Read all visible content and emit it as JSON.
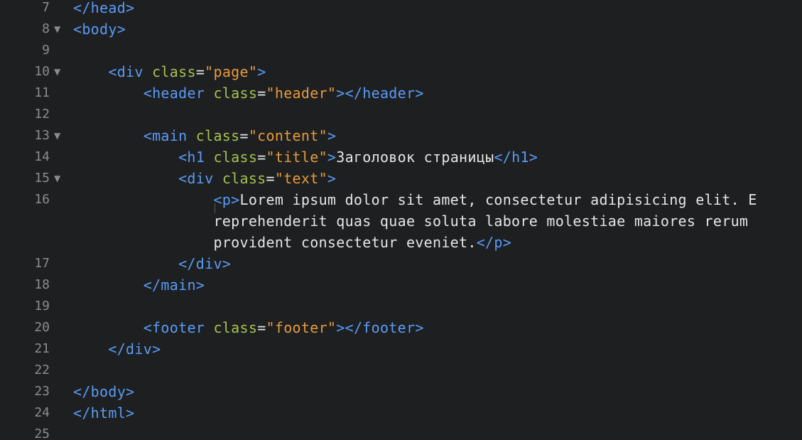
{
  "editor": {
    "lines": [
      {
        "num": "7",
        "fold": false,
        "tokens": [
          [
            "tag",
            "</head>"
          ]
        ]
      },
      {
        "num": "8",
        "fold": true,
        "tokens": [
          [
            "tag",
            "<body>"
          ]
        ]
      },
      {
        "num": "9",
        "fold": false,
        "tokens": []
      },
      {
        "num": "10",
        "fold": true,
        "tokens": [
          [
            "txt",
            "    "
          ],
          [
            "tag",
            "<div "
          ],
          [
            "attr",
            "class"
          ],
          [
            "punc",
            "="
          ],
          [
            "str",
            "\"page\""
          ],
          [
            "tag",
            ">"
          ]
        ]
      },
      {
        "num": "11",
        "fold": false,
        "tokens": [
          [
            "txt",
            "        "
          ],
          [
            "tag",
            "<header "
          ],
          [
            "attr",
            "class"
          ],
          [
            "punc",
            "="
          ],
          [
            "str",
            "\"header\""
          ],
          [
            "tag",
            "></header>"
          ]
        ]
      },
      {
        "num": "12",
        "fold": false,
        "tokens": []
      },
      {
        "num": "13",
        "fold": true,
        "tokens": [
          [
            "txt",
            "        "
          ],
          [
            "tag",
            "<main "
          ],
          [
            "attr",
            "class"
          ],
          [
            "punc",
            "="
          ],
          [
            "str",
            "\"content\""
          ],
          [
            "tag",
            ">"
          ]
        ]
      },
      {
        "num": "14",
        "fold": false,
        "tokens": [
          [
            "txt",
            "            "
          ],
          [
            "tag",
            "<h1 "
          ],
          [
            "attr",
            "class"
          ],
          [
            "punc",
            "="
          ],
          [
            "str",
            "\"title\""
          ],
          [
            "tag",
            ">"
          ],
          [
            "txt",
            "Заголовок страницы"
          ],
          [
            "tag",
            "</h1>"
          ]
        ]
      },
      {
        "num": "15",
        "fold": true,
        "tokens": [
          [
            "txt",
            "            "
          ],
          [
            "tag",
            "<div "
          ],
          [
            "attr",
            "class"
          ],
          [
            "punc",
            "="
          ],
          [
            "str",
            "\"text\""
          ],
          [
            "tag",
            ">"
          ]
        ]
      },
      {
        "num": "16",
        "fold": false,
        "tokens": [
          [
            "txt",
            "                "
          ],
          [
            "tag",
            "<p>"
          ],
          [
            "txt",
            "Lorem ipsum dolor sit amet, consectetur adipisicing elit. E"
          ]
        ]
      },
      {
        "num": "",
        "fold": false,
        "tokens": [
          [
            "txt",
            "                reprehenderit quas quae soluta labore molestiae maiores rerum"
          ]
        ]
      },
      {
        "num": "",
        "fold": false,
        "tokens": [
          [
            "txt",
            "                provident consectetur eveniet."
          ],
          [
            "tag",
            "</p>"
          ]
        ]
      },
      {
        "num": "17",
        "fold": false,
        "tokens": [
          [
            "txt",
            "            "
          ],
          [
            "tag",
            "</div>"
          ]
        ]
      },
      {
        "num": "18",
        "fold": false,
        "tokens": [
          [
            "txt",
            "        "
          ],
          [
            "tag",
            "</main>"
          ]
        ]
      },
      {
        "num": "19",
        "fold": false,
        "tokens": []
      },
      {
        "num": "20",
        "fold": false,
        "tokens": [
          [
            "txt",
            "        "
          ],
          [
            "tag",
            "<footer "
          ],
          [
            "attr",
            "class"
          ],
          [
            "punc",
            "="
          ],
          [
            "str",
            "\"footer\""
          ],
          [
            "tag",
            "></footer>"
          ]
        ]
      },
      {
        "num": "21",
        "fold": false,
        "tokens": [
          [
            "txt",
            "    "
          ],
          [
            "tag",
            "</div>"
          ]
        ]
      },
      {
        "num": "22",
        "fold": false,
        "tokens": []
      },
      {
        "num": "23",
        "fold": false,
        "tokens": [
          [
            "tag",
            "</body>"
          ]
        ]
      },
      {
        "num": "24",
        "fold": false,
        "tokens": [
          [
            "tag",
            "</html>"
          ]
        ]
      },
      {
        "num": "25",
        "fold": false,
        "tokens": []
      }
    ],
    "fold_icon": "triangle-down-icon",
    "colors": {
      "background": "#1d1f21",
      "tag": "#5b9bf5",
      "attribute": "#a8c24f",
      "string": "#e89a3c",
      "text": "#e6e6e6",
      "line_number": "#8c8c8c"
    }
  }
}
